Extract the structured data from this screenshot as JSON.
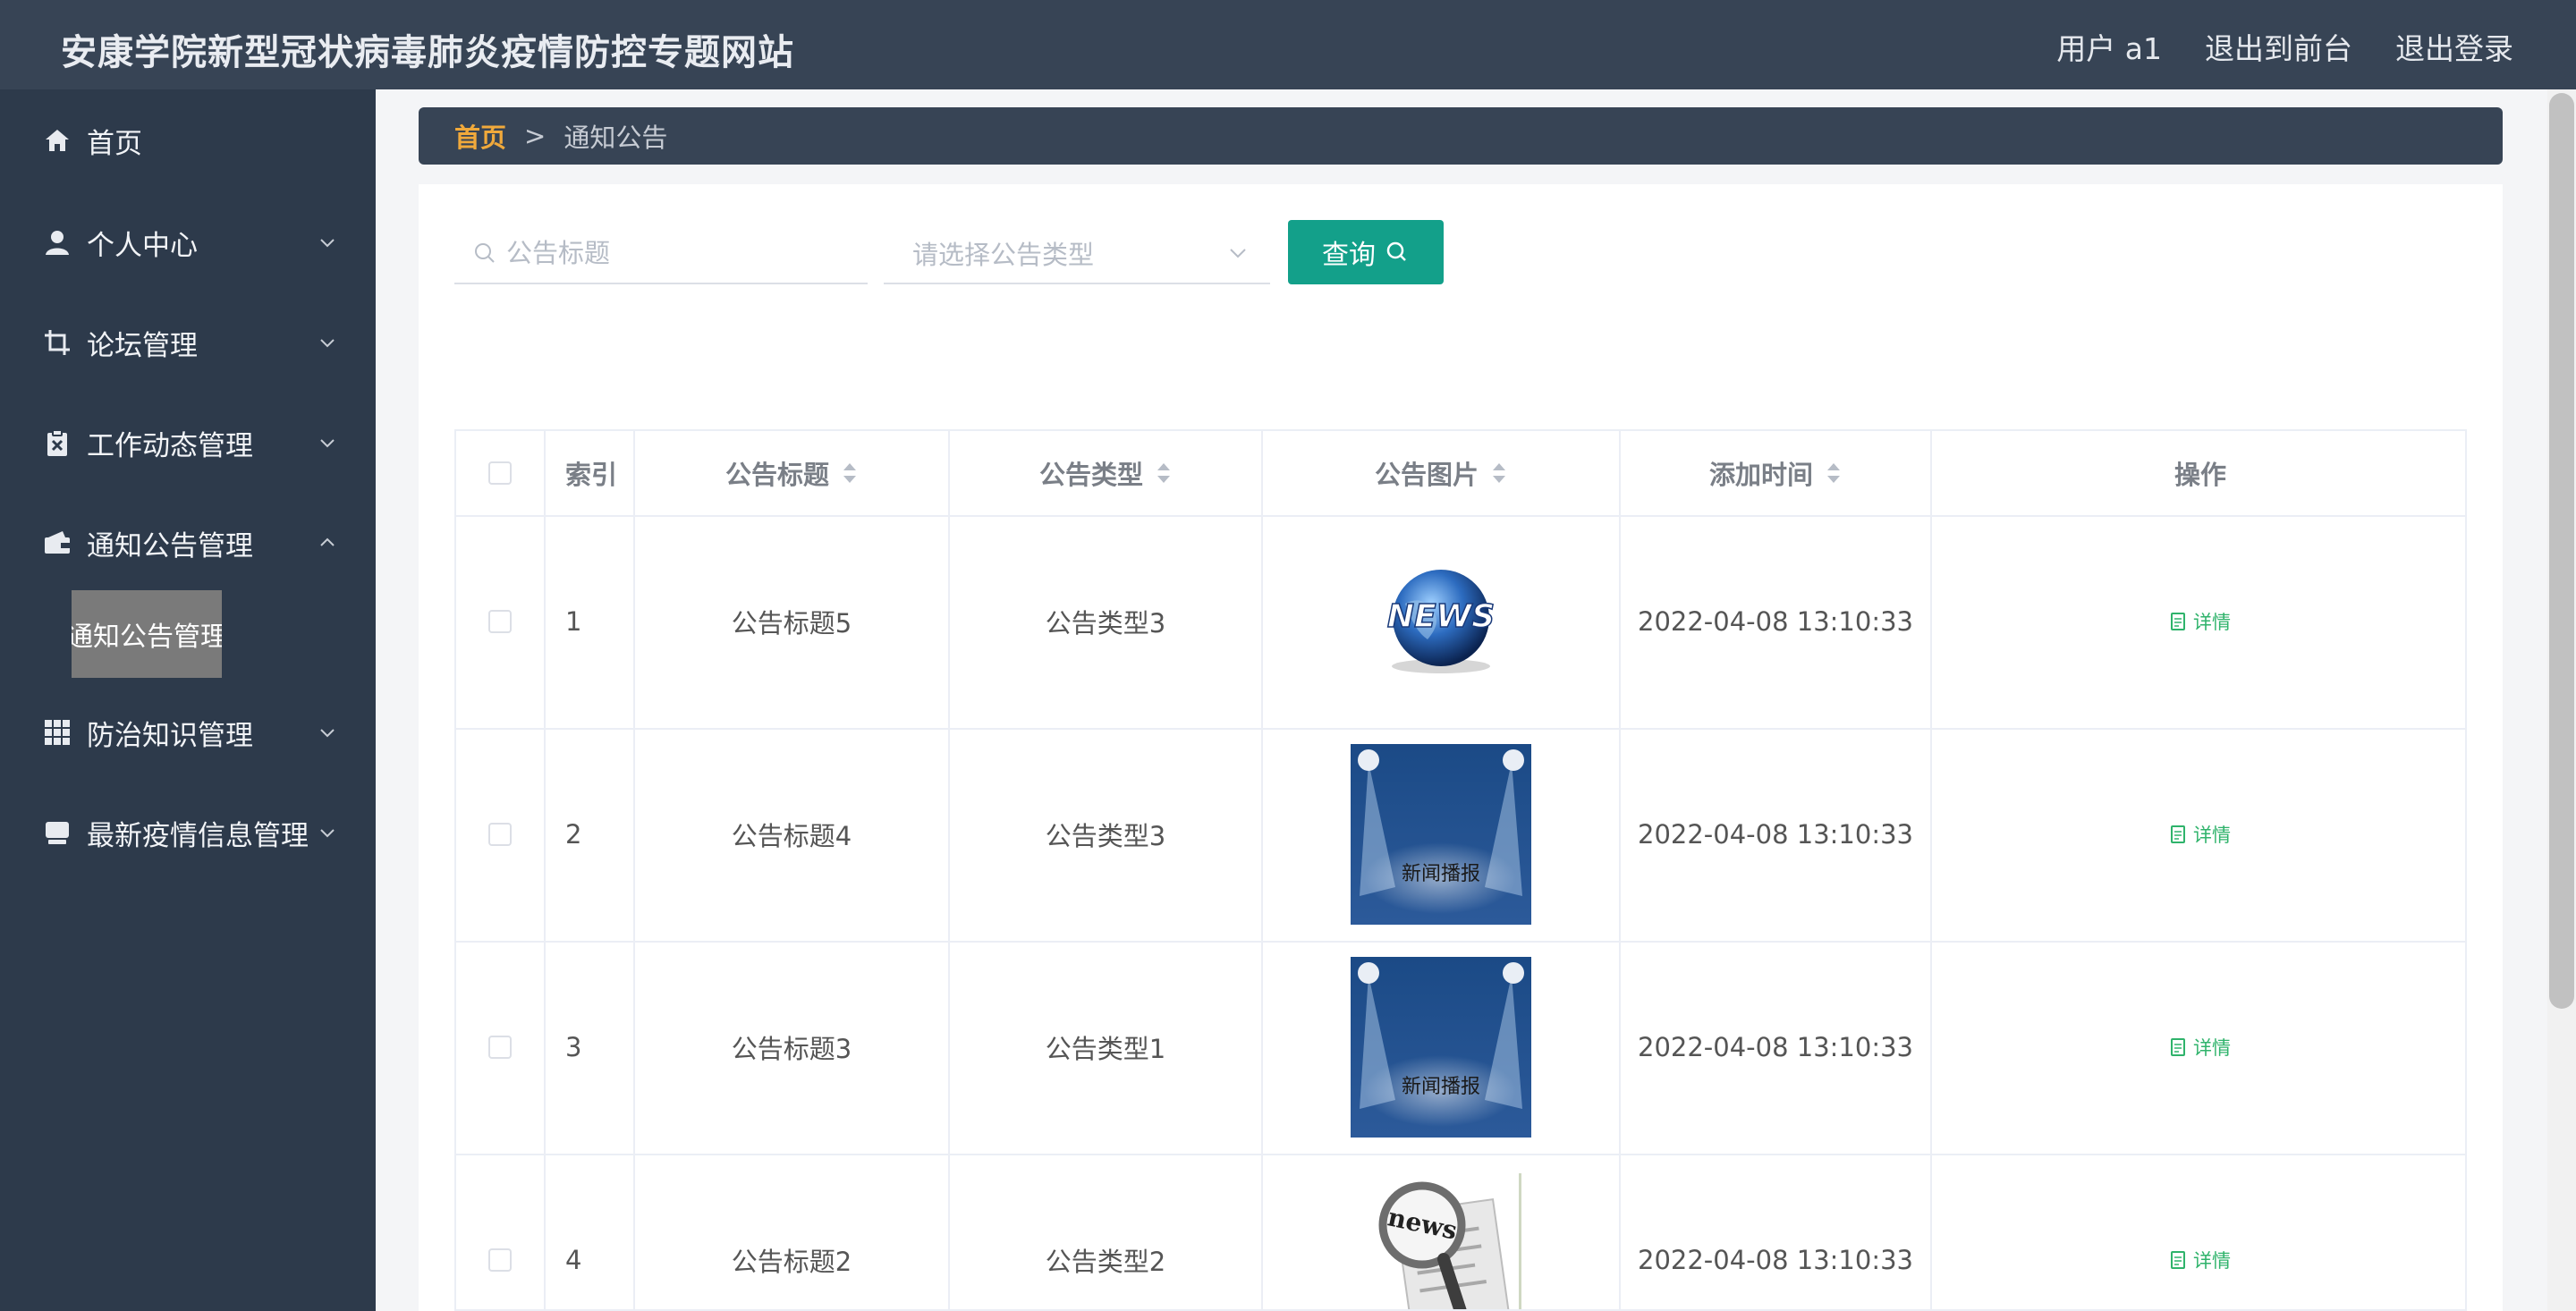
{
  "header": {
    "title": "安康学院新型冠状病毒肺炎疫情防控专题网站",
    "user": "用户 a1",
    "to_front": "退出到前台",
    "logout": "退出登录"
  },
  "sidebar": {
    "items": [
      {
        "label": "首页",
        "icon": "home-icon",
        "expandable": false
      },
      {
        "label": "个人中心",
        "icon": "user-icon",
        "expandable": true
      },
      {
        "label": "论坛管理",
        "icon": "crop-icon",
        "expandable": true
      },
      {
        "label": "工作动态管理",
        "icon": "clipboard-icon",
        "expandable": true
      },
      {
        "label": "通知公告管理",
        "icon": "wallet-icon",
        "expandable": true,
        "expanded": true
      },
      {
        "label": "防治知识管理",
        "icon": "grid-icon",
        "expandable": true
      },
      {
        "label": "最新疫情信息管理",
        "icon": "monitor-icon",
        "expandable": true
      }
    ],
    "active_submenu": "通知公告管理"
  },
  "breadcrumb": {
    "home": "首页",
    "separator": ">",
    "current": "通知公告"
  },
  "search": {
    "title_placeholder": "公告标题",
    "type_placeholder": "请选择公告类型",
    "query_label": "查询"
  },
  "table": {
    "headers": {
      "index": "索引",
      "title": "公告标题",
      "type": "公告类型",
      "image": "公告图片",
      "time": "添加时间",
      "op": "操作"
    },
    "rows": [
      {
        "index": "1",
        "title": "公告标题5",
        "type": "公告类型3",
        "image": "news-globe-image",
        "time": "2022-04-08 13:10:33",
        "op": "详情"
      },
      {
        "index": "2",
        "title": "公告标题4",
        "type": "公告类型3",
        "image": "news-broadcast-image",
        "image_text": "新闻播报",
        "time": "2022-04-08 13:10:33",
        "op": "详情"
      },
      {
        "index": "3",
        "title": "公告标题3",
        "type": "公告类型1",
        "image": "news-broadcast-image",
        "image_text": "新闻播报",
        "time": "2022-04-08 13:10:33",
        "op": "详情"
      },
      {
        "index": "4",
        "title": "公告标题2",
        "type": "公告类型2",
        "image": "news-magnifier-image",
        "image_text": "news",
        "time": "2022-04-08 13:10:33",
        "op": "详情"
      }
    ]
  },
  "colors": {
    "header_bg": "#374455",
    "sidebar_bg": "#2d3a4b",
    "accent": "#13a08a",
    "breadcrumb_home": "#f0a93b",
    "detail_link": "#2fb36b"
  }
}
